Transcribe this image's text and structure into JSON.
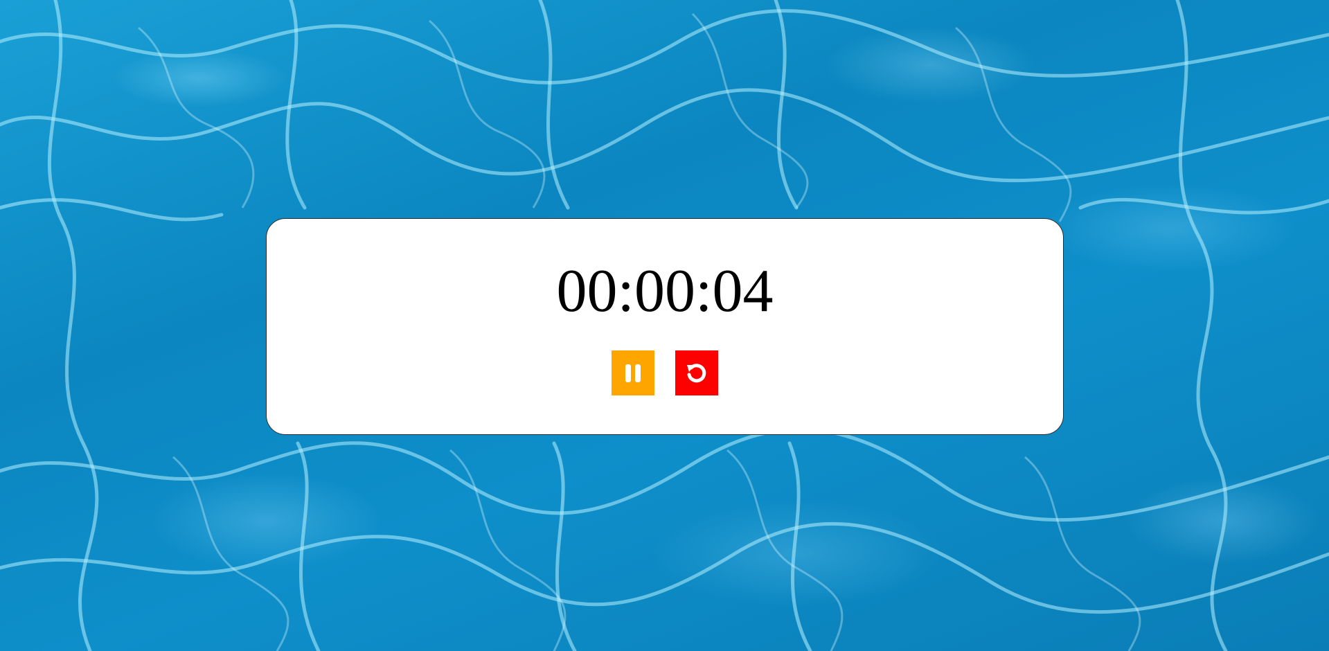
{
  "background": {
    "description_icon": "water-texture"
  },
  "timer": {
    "display": "00:00:04"
  },
  "controls": {
    "pause": {
      "icon": "pause-icon",
      "color": "#FFA500"
    },
    "reset": {
      "icon": "reset-icon",
      "color": "#FF0000"
    }
  },
  "colors": {
    "card_bg": "#FFFFFF",
    "text": "#000000",
    "water_primary": "#0B86C0"
  }
}
